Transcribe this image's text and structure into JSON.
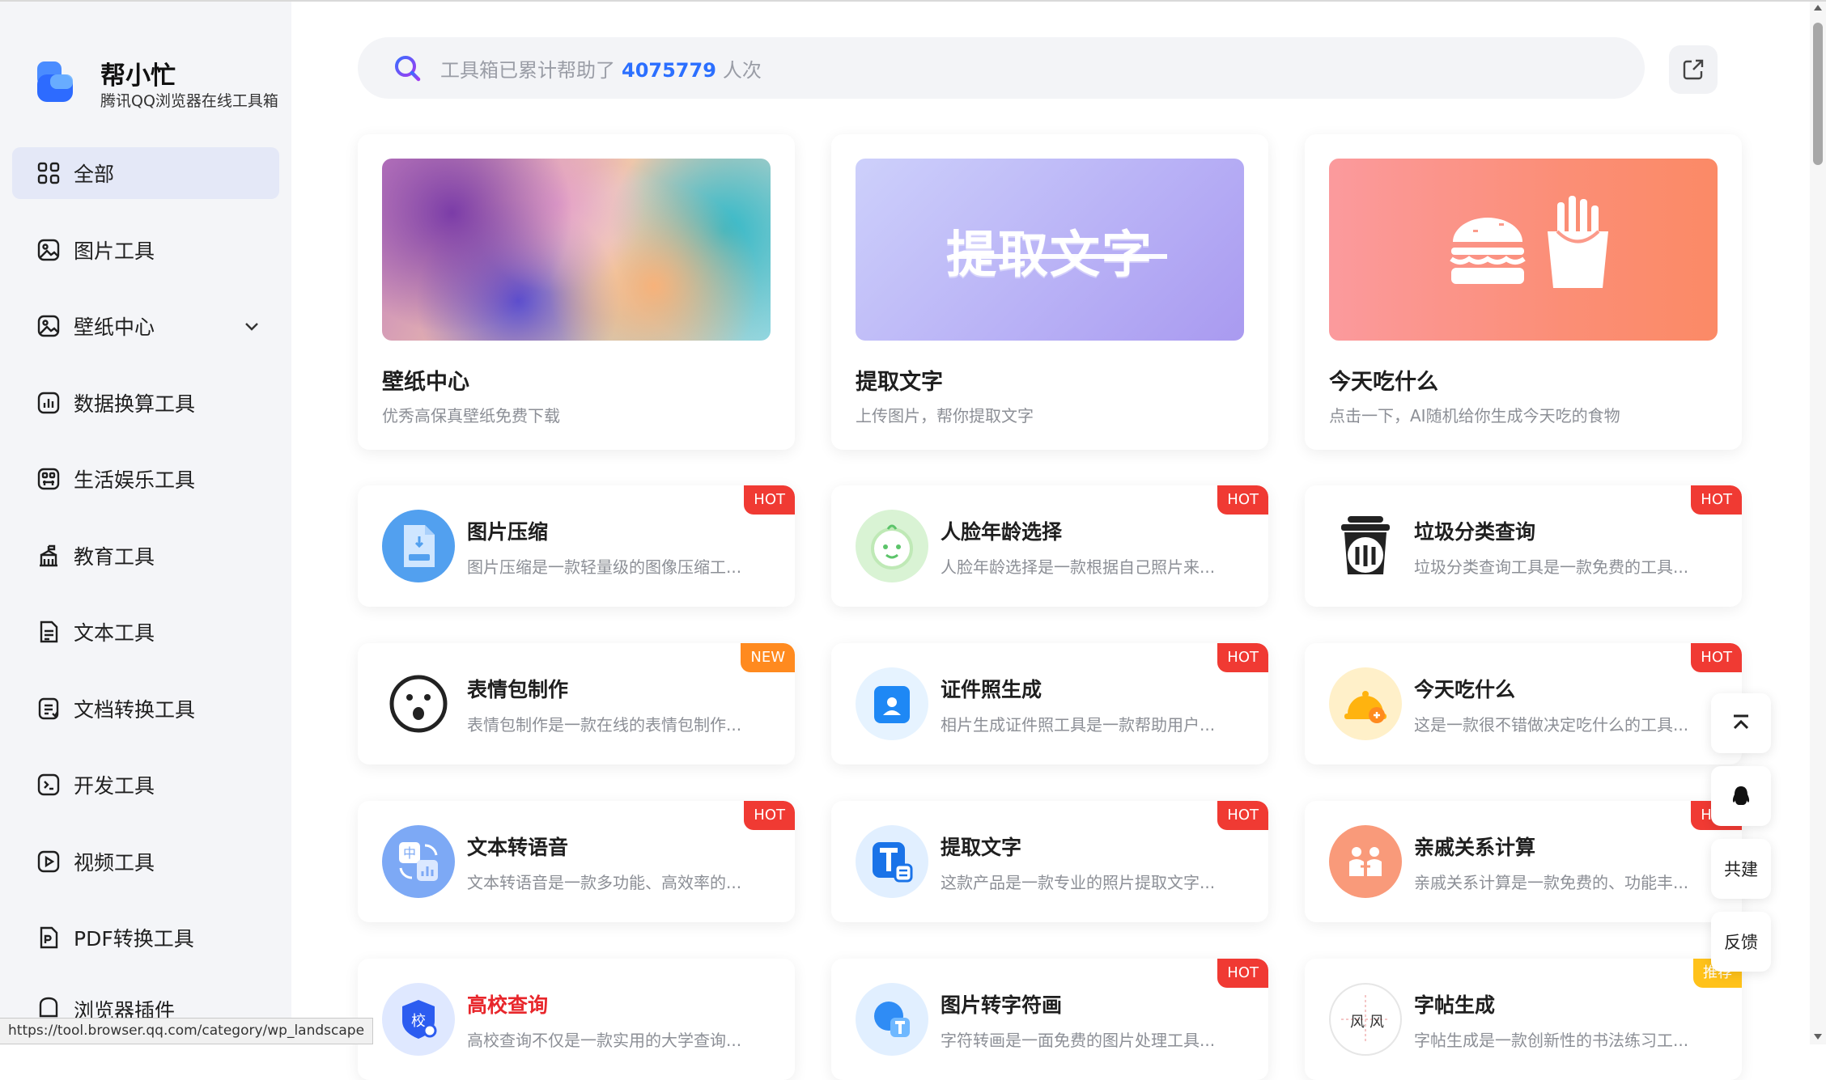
{
  "brand": {
    "name": "帮小忙",
    "subtitle": "腾讯QQ浏览器在线工具箱"
  },
  "search": {
    "prefix": "工具箱已累计帮助了",
    "count": "4075779",
    "suffix": "人次"
  },
  "sidebar": {
    "items": [
      {
        "label": "全部",
        "icon": "grid-icon",
        "active": true
      },
      {
        "label": "图片工具",
        "icon": "image-icon"
      },
      {
        "label": "壁纸中心",
        "icon": "image-icon",
        "expandable": true
      },
      {
        "label": "数据换算工具",
        "icon": "chart-icon"
      },
      {
        "label": "生活娱乐工具",
        "icon": "entertainment-icon"
      },
      {
        "label": "教育工具",
        "icon": "school-icon"
      },
      {
        "label": "文本工具",
        "icon": "document-icon"
      },
      {
        "label": "文档转换工具",
        "icon": "document-convert-icon"
      },
      {
        "label": "开发工具",
        "icon": "code-icon"
      },
      {
        "label": "视频工具",
        "icon": "video-icon"
      },
      {
        "label": "PDF转换工具",
        "icon": "pdf-icon"
      },
      {
        "label": "浏览器插件",
        "icon": "plugin-icon"
      }
    ]
  },
  "status_url": "https://tool.browser.qq.com/category/wp_landscape",
  "featured": [
    {
      "title": "壁纸中心",
      "desc": "优秀高保真壁纸免费下载"
    },
    {
      "title": "提取文字",
      "desc": "上传图片，帮你提取文字",
      "banner_text": "提取文字"
    },
    {
      "title": "今天吃什么",
      "desc": "点击一下，AI随机给你生成今天吃的食物"
    }
  ],
  "tools": [
    {
      "title": "图片压缩",
      "desc": "图片压缩是一款轻量级的图像压缩工...",
      "badge": "HOT",
      "icon": "jpeg-file-icon"
    },
    {
      "title": "人脸年龄选择",
      "desc": "人脸年龄选择是一款根据自己照片来...",
      "badge": "HOT",
      "icon": "baby-face-icon"
    },
    {
      "title": "垃圾分类查询",
      "desc": "垃圾分类查询工具是一款免费的工具...",
      "badge": "HOT",
      "icon": "trash-bin-icon"
    },
    {
      "title": "表情包制作",
      "desc": "表情包制作是一款在线的表情包制作...",
      "badge": "NEW",
      "icon": "surprised-face-icon"
    },
    {
      "title": "证件照生成",
      "desc": "相片生成证件照工具是一款帮助用户...",
      "badge": "HOT",
      "icon": "id-photo-icon"
    },
    {
      "title": "今天吃什么",
      "desc": "这是一款很不错做决定吃什么的工具...",
      "badge": "HOT",
      "icon": "food-bell-icon"
    },
    {
      "title": "文本转语音",
      "desc": "文本转语音是一款多功能、高效率的...",
      "badge": "HOT",
      "icon": "text-to-speech-icon"
    },
    {
      "title": "提取文字",
      "desc": "这款产品是一款专业的照片提取文字...",
      "badge": "HOT",
      "icon": "text-extract-icon"
    },
    {
      "title": "亲戚关系计算",
      "desc": "亲戚关系计算是一款免费的、功能丰...",
      "badge": "HOT",
      "icon": "relatives-icon"
    },
    {
      "title": "高校查询",
      "desc": "高校查询不仅是一款实用的大学查询...",
      "badge": "",
      "icon": "school-search-icon",
      "highlight": true
    },
    {
      "title": "图片转字符画",
      "desc": "字符转画是一面免费的图片处理工具...",
      "badge": "HOT",
      "icon": "image-to-text-icon"
    },
    {
      "title": "字帖生成",
      "desc": "字帖生成是一款创新性的书法练习工...",
      "badge": "推荐",
      "icon": "copybook-icon"
    }
  ],
  "float_buttons": {
    "top_icon": "back-to-top-icon",
    "qq_icon": "qq-penguin-icon",
    "cobuild": "共建",
    "feedback": "反馈"
  },
  "colors": {
    "accent": "#2b6fff",
    "hot": "#f03a33",
    "new": "#ff8a1f",
    "recommend": "#ffc21a",
    "sidebar_bg": "#f4f5f8",
    "active_bg": "#e4e8f7"
  }
}
